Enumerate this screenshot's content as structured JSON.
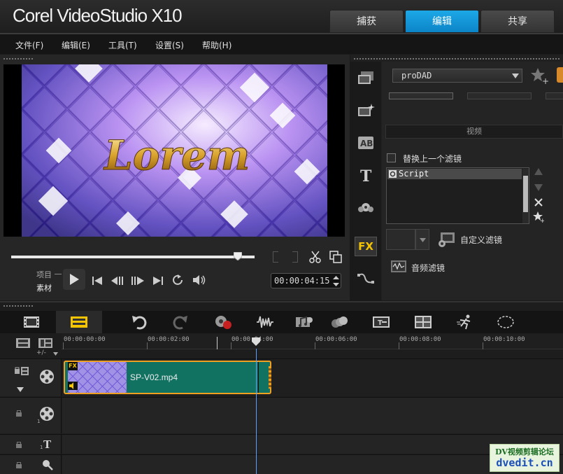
{
  "app": {
    "title": "Corel VideoStudio X10"
  },
  "tabs": [
    {
      "label": "捕获"
    },
    {
      "label": "编辑"
    },
    {
      "label": "共享"
    }
  ],
  "active_tab": "编辑",
  "menu": [
    {
      "label": "文件(F)"
    },
    {
      "label": "编辑(E)"
    },
    {
      "label": "工具(T)"
    },
    {
      "label": "设置(S)"
    },
    {
      "label": "帮助(H)"
    }
  ],
  "player": {
    "preview_text": "Lorem",
    "mode_project": "项目",
    "mode_clip": "素材",
    "timecode": "00:00:04:15",
    "scrub_position": 0.93,
    "accent": "#1da8e6"
  },
  "fx_panel": {
    "category_dropdown": "proDAD",
    "section_label": "视频",
    "replace_checkbox_label": "替换上一个滤镜",
    "replace_checked": false,
    "applied_filters": [
      "Script"
    ],
    "custom_filter_label": "自定义滤镜",
    "audio_filter_label": "音频滤镜",
    "fx_badge": "FX"
  },
  "timeline": {
    "ruler_labels": [
      "00:00:00:00",
      "00:00:02:00",
      "00:00:04:00",
      "00:00:06:00",
      "00:00:08:00",
      "00:00:10:00"
    ],
    "zoom_label": "+/-",
    "clip": {
      "name": "SP-V02.mp4",
      "fx_badge": "FX",
      "color": "#127262",
      "border": "#f0a020"
    },
    "track_numbers": [
      "1",
      "1"
    ]
  },
  "watermark": {
    "line1": "DV视频剪辑论坛",
    "line2": "dvedit.cn"
  }
}
